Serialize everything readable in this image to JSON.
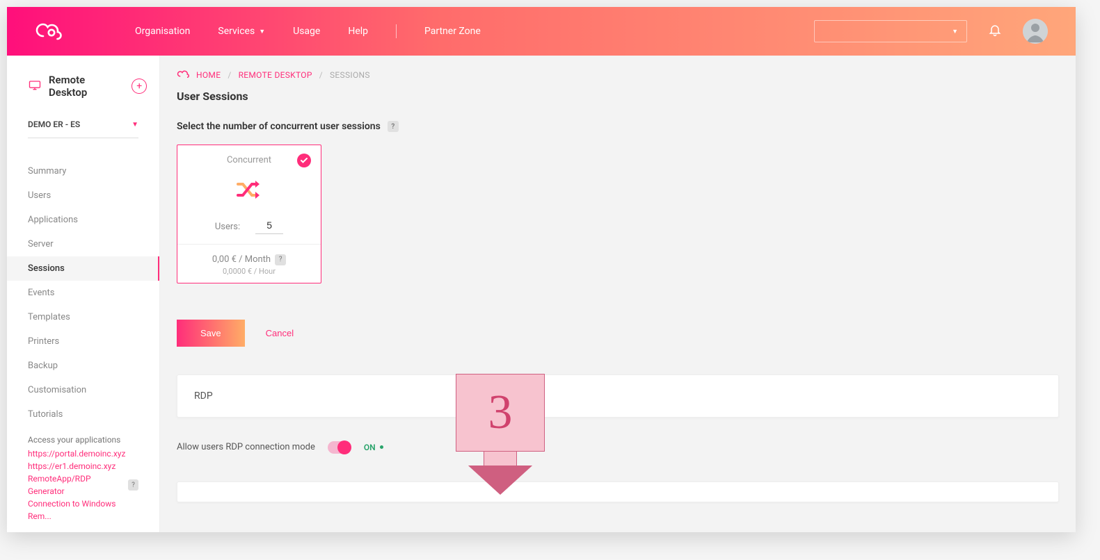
{
  "header": {
    "nav": {
      "organisation": "Organisation",
      "services": "Services",
      "usage": "Usage",
      "help": "Help",
      "partner": "Partner Zone"
    }
  },
  "sidebar": {
    "title": "Remote Desktop",
    "org_selected": "DEMO ER - ES",
    "items": [
      {
        "label": "Summary"
      },
      {
        "label": "Users"
      },
      {
        "label": "Applications"
      },
      {
        "label": "Server"
      },
      {
        "label": "Sessions"
      },
      {
        "label": "Events"
      },
      {
        "label": "Templates"
      },
      {
        "label": "Printers"
      },
      {
        "label": "Backup"
      },
      {
        "label": "Customisation"
      },
      {
        "label": "Tutorials"
      }
    ],
    "footer": {
      "heading": "Access your applications",
      "links": {
        "portal": "https://portal.demoinc.xyz",
        "er1": "https://er1.demoinc.xyz",
        "generator": "RemoteApp/RDP Generator",
        "conn_windows": "Connection to Windows Rem..."
      }
    }
  },
  "breadcrumb": {
    "home": "HOME",
    "remote_desktop": "REMOTE DESKTOP",
    "sessions": "SESSIONS"
  },
  "page": {
    "title": "User Sessions",
    "prompt": "Select the number of concurrent user sessions"
  },
  "card": {
    "title": "Concurrent",
    "users_label": "Users:",
    "users_value": "5",
    "price_month": "0,00 € / Month",
    "price_hour": "0,0000 € / Hour"
  },
  "actions": {
    "save": "Save",
    "cancel": "Cancel"
  },
  "rdp": {
    "panel_title": "RDP",
    "toggle_label": "Allow users RDP connection mode",
    "toggle_state": "ON"
  },
  "annotation": {
    "number": "3"
  }
}
